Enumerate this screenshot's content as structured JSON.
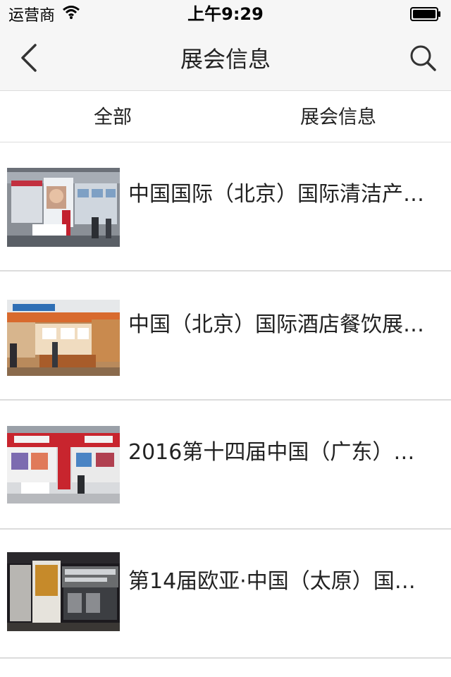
{
  "status_bar": {
    "carrier": "运营商",
    "time": "上午9:29"
  },
  "nav": {
    "title": "展会信息",
    "back_icon": "chevron-left-icon",
    "search_icon": "search-icon"
  },
  "tabs": [
    {
      "label": "全部"
    },
    {
      "label": "展会信息"
    }
  ],
  "list": {
    "items": [
      {
        "title": "中国国际（北京）国际清洁产…",
        "thumb": "exhibition-booth-image"
      },
      {
        "title": "中国（北京）国际酒店餐饮展…",
        "thumb": "exhibition-booth-image"
      },
      {
        "title": "2016第十四届中国（广东）…",
        "thumb": "exhibition-booth-image"
      },
      {
        "title": "第14届欧亚·中国（太原）国…",
        "thumb": "exhibition-booth-image"
      }
    ]
  }
}
